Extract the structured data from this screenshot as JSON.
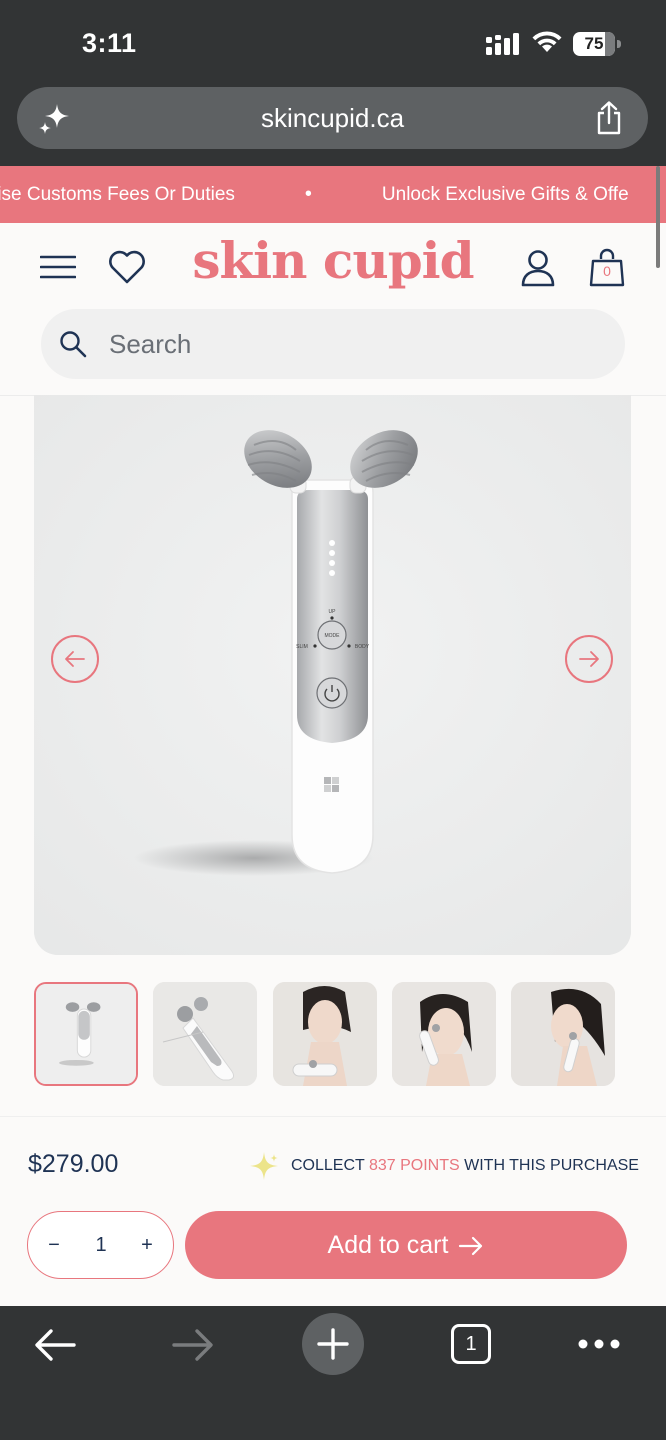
{
  "status_bar": {
    "time": "3:11",
    "battery_level": "75",
    "battery_fraction": 0.75
  },
  "address_bar": {
    "url": "skincupid.ca"
  },
  "announcement": {
    "items": [
      "rise Customs Fees Or Duties",
      "Unlock Exclusive Gifts & Offe"
    ],
    "separator": "•"
  },
  "header": {
    "logo": "skin cupid",
    "cart_count": "0"
  },
  "search": {
    "placeholder": "Search"
  },
  "product": {
    "device_labels": {
      "up": "UP",
      "mode": "MODE",
      "slim": "SLIM",
      "body": "BODY"
    },
    "thumbnails": [
      "device-front",
      "device-angle",
      "model-neck",
      "model-face",
      "model-jaw"
    ],
    "price": "$279.00",
    "points": {
      "prefix": "COLLECT",
      "amount": "837 POINTS",
      "suffix": "WITH THIS PURCHASE"
    },
    "quantity": {
      "minus": "−",
      "value": "1",
      "plus": "+"
    },
    "add_to_cart": "Add to cart"
  },
  "toolbar": {
    "tab_count": "1"
  },
  "colors": {
    "brand": "#e8767e",
    "navy": "#1f3354",
    "chrome": "#323435"
  }
}
